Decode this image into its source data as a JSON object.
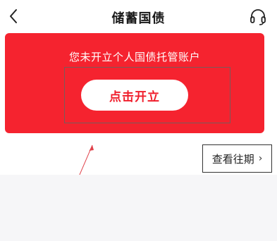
{
  "nav": {
    "title": "储蓄国债",
    "back_icon": "chevron-left-icon",
    "service_icon": "headset-icon"
  },
  "account_card": {
    "message": "您未开立个人国债托管账户",
    "open_button_label": "点击开立",
    "background_color": "#f5232f"
  },
  "past_issues": {
    "label": "查看往期",
    "chevron": "›"
  }
}
